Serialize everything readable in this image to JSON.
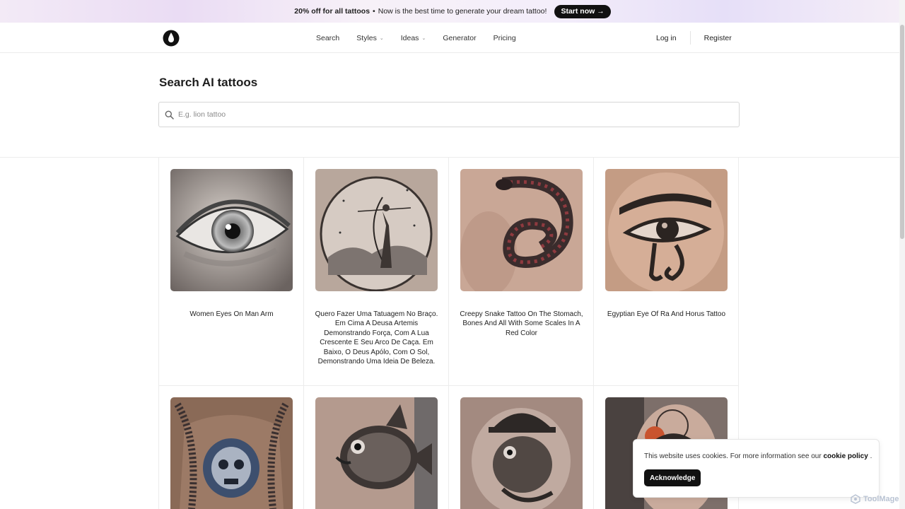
{
  "promo": {
    "highlight": "20% off for all tattoos",
    "separator": "•",
    "message": "Now is the best time to generate your dream tattoo!",
    "cta": "Start now →"
  },
  "nav": {
    "links": [
      "Search",
      "Styles",
      "Ideas",
      "Generator",
      "Pricing"
    ],
    "login": "Log in",
    "register": "Register"
  },
  "page": {
    "title": "Search AI tattoos",
    "search_placeholder": "E.g. lion tattoo"
  },
  "results": [
    {
      "caption": "Women Eyes On Man Arm",
      "icon": "eye-tattoo-image"
    },
    {
      "caption": "Quero Fazer Uma Tatuagem No Braço. Em Cima A Deusa Artemis Demonstrando Força, Com A Lua Crescente E Seu Arco De Caça. Em Baixo, O Deus Apólo, Com O Sol, Demonstrando Uma Ideia De Beleza.",
      "icon": "archer-tattoo-image"
    },
    {
      "caption": "Creepy Snake Tattoo On The Stomach, Bones And All With Some Scales In A Red Color",
      "icon": "snake-tattoo-image"
    },
    {
      "caption": "Egyptian Eye Of Ra And Horus Tattoo",
      "icon": "eye-of-horus-tattoo-image"
    },
    {
      "caption": "",
      "icon": "skull-chest-tattoo-image"
    },
    {
      "caption": "",
      "icon": "fish-tattoo-image"
    },
    {
      "caption": "",
      "icon": "fish-helmet-tattoo-image"
    },
    {
      "caption": "",
      "icon": "woman-helmet-tattoo-image"
    }
  ],
  "cookie": {
    "text": "This website uses cookies. For more information see our",
    "link": "cookie policy",
    "suffix": ".",
    "button": "Acknowledge"
  },
  "watermark": "ToolMage"
}
